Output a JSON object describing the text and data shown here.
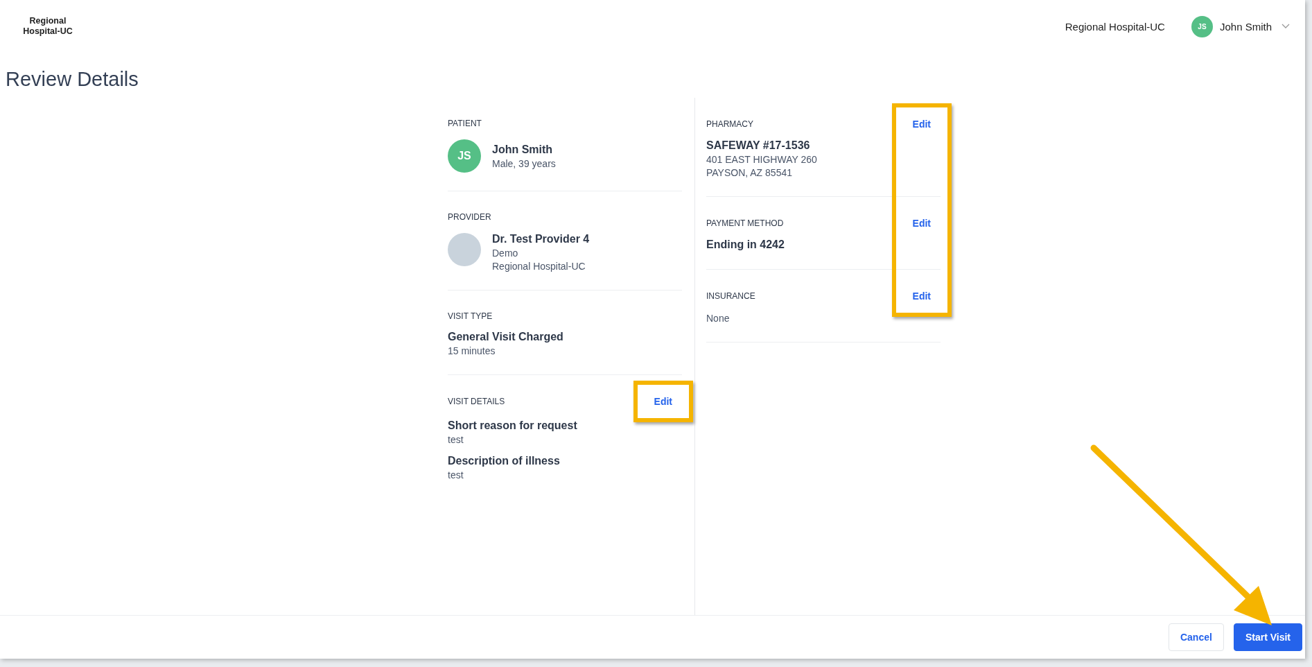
{
  "header": {
    "logo": "Regional Hospital-UC",
    "organization": "Regional Hospital-UC",
    "user": {
      "initials": "JS",
      "name": "John Smith"
    }
  },
  "page_title": "Review Details",
  "left_sections": [
    {
      "kind": "patient",
      "label": "PATIENT",
      "avatar_initials": "JS",
      "title": "John Smith",
      "lines": [
        "Male, 39 years"
      ]
    },
    {
      "kind": "provider",
      "label": "PROVIDER",
      "title": "Dr. Test Provider 4",
      "lines": [
        "Demo",
        "Regional Hospital-UC"
      ]
    },
    {
      "kind": "text",
      "label": "VISIT TYPE",
      "title": "General Visit Charged",
      "lines": [
        "15 minutes"
      ]
    },
    {
      "kind": "fields",
      "label": "VISIT DETAILS",
      "edit": "Edit",
      "edit_highlighted": true,
      "fields": [
        {
          "title": "Short reason for request",
          "value": "test"
        },
        {
          "title": "Description of illness",
          "value": "test"
        }
      ]
    }
  ],
  "right_sections": [
    {
      "kind": "text",
      "label": "PHARMACY",
      "edit": "Edit",
      "title": "SAFEWAY #17-1536",
      "lines": [
        "401 EAST HIGHWAY 260",
        "PAYSON, AZ 85541"
      ]
    },
    {
      "kind": "text",
      "label": "PAYMENT METHOD",
      "edit": "Edit",
      "title": "Ending in 4242"
    },
    {
      "kind": "plain",
      "label": "INSURANCE",
      "edit": "Edit",
      "lines": [
        "None"
      ]
    }
  ],
  "right_edits_highlighted": true,
  "footer": {
    "cancel": "Cancel",
    "start": "Start Visit",
    "start_arrow": true
  }
}
